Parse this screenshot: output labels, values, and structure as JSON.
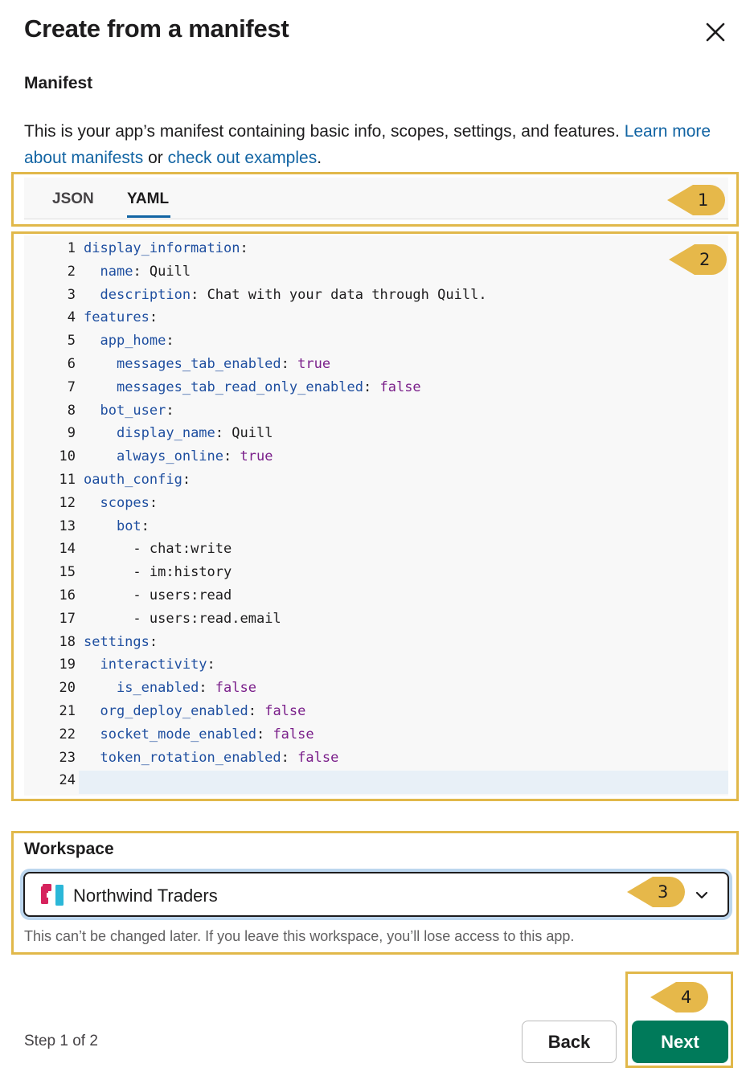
{
  "dialog": {
    "title": "Create from a manifest",
    "close_icon": "close-icon"
  },
  "manifest": {
    "label": "Manifest",
    "description_text": "This is your app’s manifest containing basic info, scopes, settings, and features. ",
    "learn_more_link": "Learn more about manifests",
    "or_text": " or ",
    "examples_link": "check out examples",
    "period": "."
  },
  "tabs": [
    {
      "label": "JSON",
      "active": false
    },
    {
      "label": "YAML",
      "active": true
    }
  ],
  "editor": {
    "lines": [
      {
        "n": "1",
        "indent": "",
        "key": "display_information",
        "sep": ":",
        "value": "",
        "vtype": ""
      },
      {
        "n": "2",
        "indent": "  ",
        "key": "name",
        "sep": ": ",
        "value": "Quill",
        "vtype": "str"
      },
      {
        "n": "3",
        "indent": "  ",
        "key": "description",
        "sep": ": ",
        "value": "Chat with your data through Quill.",
        "vtype": "str"
      },
      {
        "n": "4",
        "indent": "",
        "key": "features",
        "sep": ":",
        "value": "",
        "vtype": ""
      },
      {
        "n": "5",
        "indent": "  ",
        "key": "app_home",
        "sep": ":",
        "value": "",
        "vtype": ""
      },
      {
        "n": "6",
        "indent": "    ",
        "key": "messages_tab_enabled",
        "sep": ": ",
        "value": "true",
        "vtype": "bool"
      },
      {
        "n": "7",
        "indent": "    ",
        "key": "messages_tab_read_only_enabled",
        "sep": ": ",
        "value": "false",
        "vtype": "bool"
      },
      {
        "n": "8",
        "indent": "  ",
        "key": "bot_user",
        "sep": ":",
        "value": "",
        "vtype": ""
      },
      {
        "n": "9",
        "indent": "    ",
        "key": "display_name",
        "sep": ": ",
        "value": "Quill",
        "vtype": "str"
      },
      {
        "n": "10",
        "indent": "    ",
        "key": "always_online",
        "sep": ": ",
        "value": "true",
        "vtype": "bool"
      },
      {
        "n": "11",
        "indent": "",
        "key": "oauth_config",
        "sep": ":",
        "value": "",
        "vtype": ""
      },
      {
        "n": "12",
        "indent": "  ",
        "key": "scopes",
        "sep": ":",
        "value": "",
        "vtype": ""
      },
      {
        "n": "13",
        "indent": "    ",
        "key": "bot",
        "sep": ":",
        "value": "",
        "vtype": ""
      },
      {
        "n": "14",
        "indent": "      ",
        "key": "",
        "sep": "- ",
        "value": "chat:write",
        "vtype": "str"
      },
      {
        "n": "15",
        "indent": "      ",
        "key": "",
        "sep": "- ",
        "value": "im:history",
        "vtype": "str"
      },
      {
        "n": "16",
        "indent": "      ",
        "key": "",
        "sep": "- ",
        "value": "users:read",
        "vtype": "str"
      },
      {
        "n": "17",
        "indent": "      ",
        "key": "",
        "sep": "- ",
        "value": "users:read.email",
        "vtype": "str"
      },
      {
        "n": "18",
        "indent": "",
        "key": "settings",
        "sep": ":",
        "value": "",
        "vtype": ""
      },
      {
        "n": "19",
        "indent": "  ",
        "key": "interactivity",
        "sep": ":",
        "value": "",
        "vtype": ""
      },
      {
        "n": "20",
        "indent": "    ",
        "key": "is_enabled",
        "sep": ": ",
        "value": "false",
        "vtype": "bool"
      },
      {
        "n": "21",
        "indent": "  ",
        "key": "org_deploy_enabled",
        "sep": ": ",
        "value": "false",
        "vtype": "bool"
      },
      {
        "n": "22",
        "indent": "  ",
        "key": "socket_mode_enabled",
        "sep": ": ",
        "value": "false",
        "vtype": "bool"
      },
      {
        "n": "23",
        "indent": "  ",
        "key": "token_rotation_enabled",
        "sep": ": ",
        "value": "false",
        "vtype": "bool"
      },
      {
        "n": "24",
        "indent": "",
        "key": "",
        "sep": "",
        "value": "",
        "vtype": ""
      }
    ],
    "current_line": "24"
  },
  "workspace": {
    "label": "Workspace",
    "selected": "Northwind Traders",
    "logo_icon": "workspace-logo-icon",
    "dropdown_icon": "chevron-down-icon",
    "note": "This can’t be changed later. If you leave this workspace, you’ll lose access to this app."
  },
  "footer": {
    "step": "Step 1 of 2",
    "back_label": "Back",
    "next_label": "Next"
  },
  "annotations": [
    {
      "number": "1"
    },
    {
      "number": "2"
    },
    {
      "number": "3"
    },
    {
      "number": "4"
    }
  ],
  "colors": {
    "highlight": "#e1b84a",
    "link": "#1264a3",
    "primary_button": "#007a5a",
    "yaml_key": "#1f4fa0",
    "yaml_bool": "#7a1f8a"
  }
}
